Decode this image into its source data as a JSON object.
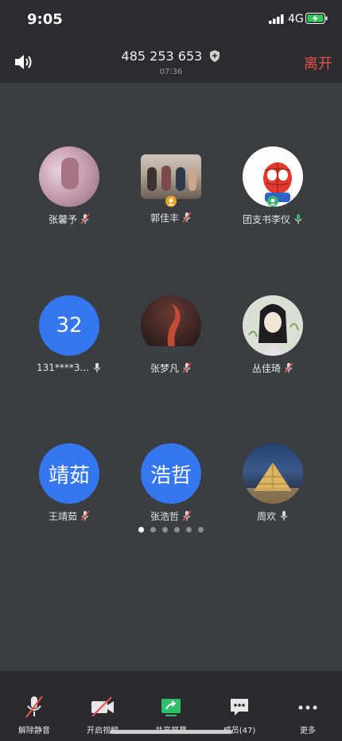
{
  "status": {
    "time": "9:05",
    "network": "4G"
  },
  "header": {
    "meeting_id": "485 253 653",
    "duration": "07:36",
    "leave_label": "离开"
  },
  "participants": [
    {
      "name": "张馨予",
      "initials": "",
      "mic": "muted"
    },
    {
      "name": "郭佳丰",
      "initials": "",
      "mic": "muted"
    },
    {
      "name": "团支书李仪",
      "initials": "",
      "mic": "on"
    },
    {
      "name": "131****3...",
      "initials": "32",
      "mic": "on"
    },
    {
      "name": "张梦凡",
      "initials": "",
      "mic": "muted"
    },
    {
      "name": "丛佳琦",
      "initials": "",
      "mic": "muted"
    },
    {
      "name": "王靖茹",
      "initials": "靖茹",
      "mic": "muted"
    },
    {
      "name": "张浩哲",
      "initials": "浩哲",
      "mic": "muted"
    },
    {
      "name": "周欢",
      "initials": "",
      "mic": "on"
    }
  ],
  "pagination": {
    "pages": 6,
    "current": 1
  },
  "toolbar": {
    "unmute_label": "解除静音",
    "video_label": "开启视频",
    "share_label": "共享屏幕",
    "members_label": "成员(47)",
    "more_label": "更多"
  },
  "colors": {
    "accent_blue": "#3577f0",
    "leave_red": "#e8514a",
    "share_green": "#2fbf6a"
  }
}
